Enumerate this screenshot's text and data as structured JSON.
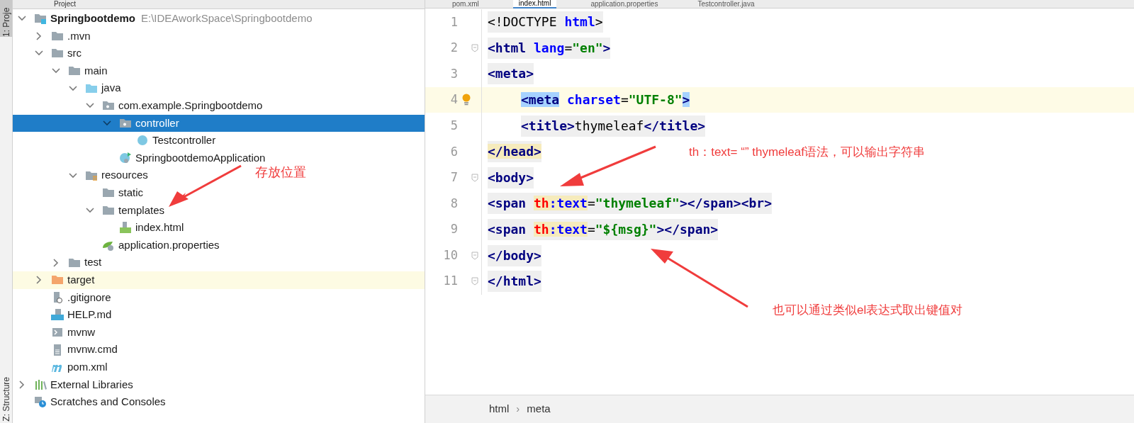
{
  "side_strip": {
    "top_label": "1: Proje",
    "bottom_label": "Z: Structure"
  },
  "project_panel": {
    "title": "Project",
    "tree": [
      {
        "label": "Springbootdemo",
        "hint": "E:\\IDEAworkSpace\\Springbootdemo",
        "kind": "project",
        "expanded": true,
        "selected": false,
        "highlighted": false,
        "children": [
          {
            "label": ".mvn",
            "kind": "folder",
            "expanded": false,
            "selected": false,
            "highlighted": false
          },
          {
            "label": "src",
            "kind": "folder",
            "expanded": true,
            "selected": false,
            "highlighted": false,
            "children": [
              {
                "label": "main",
                "kind": "folder",
                "expanded": true,
                "selected": false,
                "highlighted": false,
                "children": [
                  {
                    "label": "java",
                    "kind": "sources",
                    "expanded": true,
                    "selected": false,
                    "highlighted": false,
                    "children": [
                      {
                        "label": "com.example.Springbootdemo",
                        "kind": "package",
                        "expanded": true,
                        "selected": false,
                        "highlighted": false,
                        "children": [
                          {
                            "label": "controller",
                            "kind": "package",
                            "expanded": true,
                            "selected": true,
                            "highlighted": false,
                            "children": [
                              {
                                "label": "Testcontroller",
                                "kind": "class",
                                "selected": false
                              }
                            ]
                          },
                          {
                            "label": "SpringbootdemoApplication",
                            "kind": "application",
                            "selected": false,
                            "highlighted": false
                          }
                        ]
                      }
                    ]
                  },
                  {
                    "label": "resources",
                    "kind": "resources",
                    "expanded": true,
                    "selected": false,
                    "highlighted": false,
                    "children": [
                      {
                        "label": "static",
                        "kind": "folder",
                        "selected": false,
                        "highlighted": false
                      },
                      {
                        "label": "templates",
                        "kind": "folder",
                        "expanded": true,
                        "selected": false,
                        "highlighted": false,
                        "children": [
                          {
                            "label": "index.html",
                            "kind": "html",
                            "selected": false,
                            "highlighted": false
                          }
                        ]
                      },
                      {
                        "label": "application.properties",
                        "kind": "properties",
                        "selected": false,
                        "highlighted": false
                      }
                    ]
                  }
                ]
              },
              {
                "label": "test",
                "kind": "folder",
                "expanded": false,
                "selected": false,
                "highlighted": false
              }
            ]
          },
          {
            "label": "target",
            "kind": "excluded",
            "expanded": false,
            "selected": false,
            "highlighted": true
          },
          {
            "label": ".gitignore",
            "kind": "ignore",
            "selected": false,
            "highlighted": false
          },
          {
            "label": "HELP.md",
            "kind": "markdown",
            "selected": false,
            "highlighted": false
          },
          {
            "label": "mvnw",
            "kind": "shell",
            "selected": false,
            "highlighted": false
          },
          {
            "label": "mvnw.cmd",
            "kind": "text",
            "selected": false,
            "highlighted": false
          },
          {
            "label": "pom.xml",
            "kind": "maven",
            "selected": false,
            "highlighted": false
          }
        ]
      },
      {
        "label": "External Libraries",
        "kind": "libraries",
        "expanded": false,
        "selected": false,
        "highlighted": false
      },
      {
        "label": "Scratches and Consoles",
        "kind": "scratches",
        "selected": false,
        "highlighted": false
      }
    ]
  },
  "editor": {
    "tabs": [
      {
        "label": "pom.xml",
        "selected": false
      },
      {
        "label": "index.html",
        "selected": true
      },
      {
        "label": "application.properties",
        "selected": false
      },
      {
        "label": "Testcontroller.java",
        "selected": false
      }
    ],
    "lines": [
      {
        "number": "1",
        "fold": false,
        "current": false,
        "bulb": false,
        "tokens": [
          {
            "text": "<!DOCTYPE ",
            "kind": "plain"
          },
          {
            "text": "html",
            "kind": "attr"
          },
          {
            "text": ">",
            "kind": "plain"
          }
        ]
      },
      {
        "number": "2",
        "fold": true,
        "current": false,
        "bulb": false,
        "tokens": [
          {
            "text": "<html ",
            "kind": "tag"
          },
          {
            "text": "lang",
            "kind": "attr"
          },
          {
            "text": "=",
            "kind": "plain"
          },
          {
            "text": "\"en\"",
            "kind": "value"
          },
          {
            "text": ">",
            "kind": "tag"
          }
        ]
      },
      {
        "number": "3",
        "fold": false,
        "current": false,
        "bulb": false,
        "tokens": [
          {
            "text": "<meta>",
            "kind": "tag"
          }
        ],
        "children": [
          {
            "number": "4",
            "fold": false,
            "current": true,
            "bulb": true,
            "tokens": [
              {
                "text": "<meta",
                "kind": "tag",
                "matched": true
              },
              {
                "text": " charset",
                "kind": "attr"
              },
              {
                "text": "=",
                "kind": "plain"
              },
              {
                "text": "\"UTF-8\"",
                "kind": "value"
              },
              {
                "text": ">",
                "kind": "tag",
                "matched": true
              }
            ]
          },
          {
            "number": "5",
            "fold": false,
            "current": false,
            "bulb": false,
            "tokens": [
              {
                "text": "<title>",
                "kind": "tag"
              },
              {
                "text": "thymeleaf",
                "kind": "plain"
              },
              {
                "text": "</title>",
                "kind": "tag"
              }
            ]
          }
        ]
      },
      {
        "number": "6",
        "fold": false,
        "current": false,
        "bulb": false,
        "tokens": [
          {
            "text": "</head>",
            "kind": "tag",
            "marked": true
          }
        ]
      },
      {
        "number": "7",
        "fold": true,
        "current": false,
        "bulb": false,
        "tokens": [
          {
            "text": "<body>",
            "kind": "tag"
          }
        ]
      },
      {
        "number": "8",
        "fold": false,
        "current": false,
        "bulb": false,
        "tokens": [
          {
            "text": "<span ",
            "kind": "tag"
          },
          {
            "text": "th",
            "kind": "th",
            "marked": true
          },
          {
            "text": ":text",
            "kind": "attr",
            "marked": true
          },
          {
            "text": "=",
            "kind": "plain"
          },
          {
            "text": "\"thymeleaf\"",
            "kind": "value"
          },
          {
            "text": "></span><br>",
            "kind": "tag"
          }
        ]
      },
      {
        "number": "9",
        "fold": false,
        "current": false,
        "bulb": false,
        "tokens": [
          {
            "text": "<span ",
            "kind": "tag"
          },
          {
            "text": "th",
            "kind": "th",
            "marked": true
          },
          {
            "text": ":text",
            "kind": "attr",
            "marked": true
          },
          {
            "text": "=",
            "kind": "plain"
          },
          {
            "text": "\"${msg}\"",
            "kind": "value"
          },
          {
            "text": "></span>",
            "kind": "tag"
          }
        ]
      },
      {
        "number": "10",
        "fold": true,
        "current": false,
        "bulb": false,
        "tokens": [
          {
            "text": "</body>",
            "kind": "tag"
          }
        ]
      },
      {
        "number": "11",
        "fold": true,
        "current": false,
        "bulb": false,
        "tokens": [
          {
            "text": "</html>",
            "kind": "tag"
          }
        ]
      }
    ],
    "breadcrumbs": [
      "html",
      "meta"
    ],
    "breadcrumb_separator": "›"
  },
  "annotations": [
    {
      "text": "存放位置"
    },
    {
      "text": "th：text= “” thymeleaf语法，可以输出字符串"
    },
    {
      "text": "也可以通过类似el表达式取出键值对"
    }
  ]
}
